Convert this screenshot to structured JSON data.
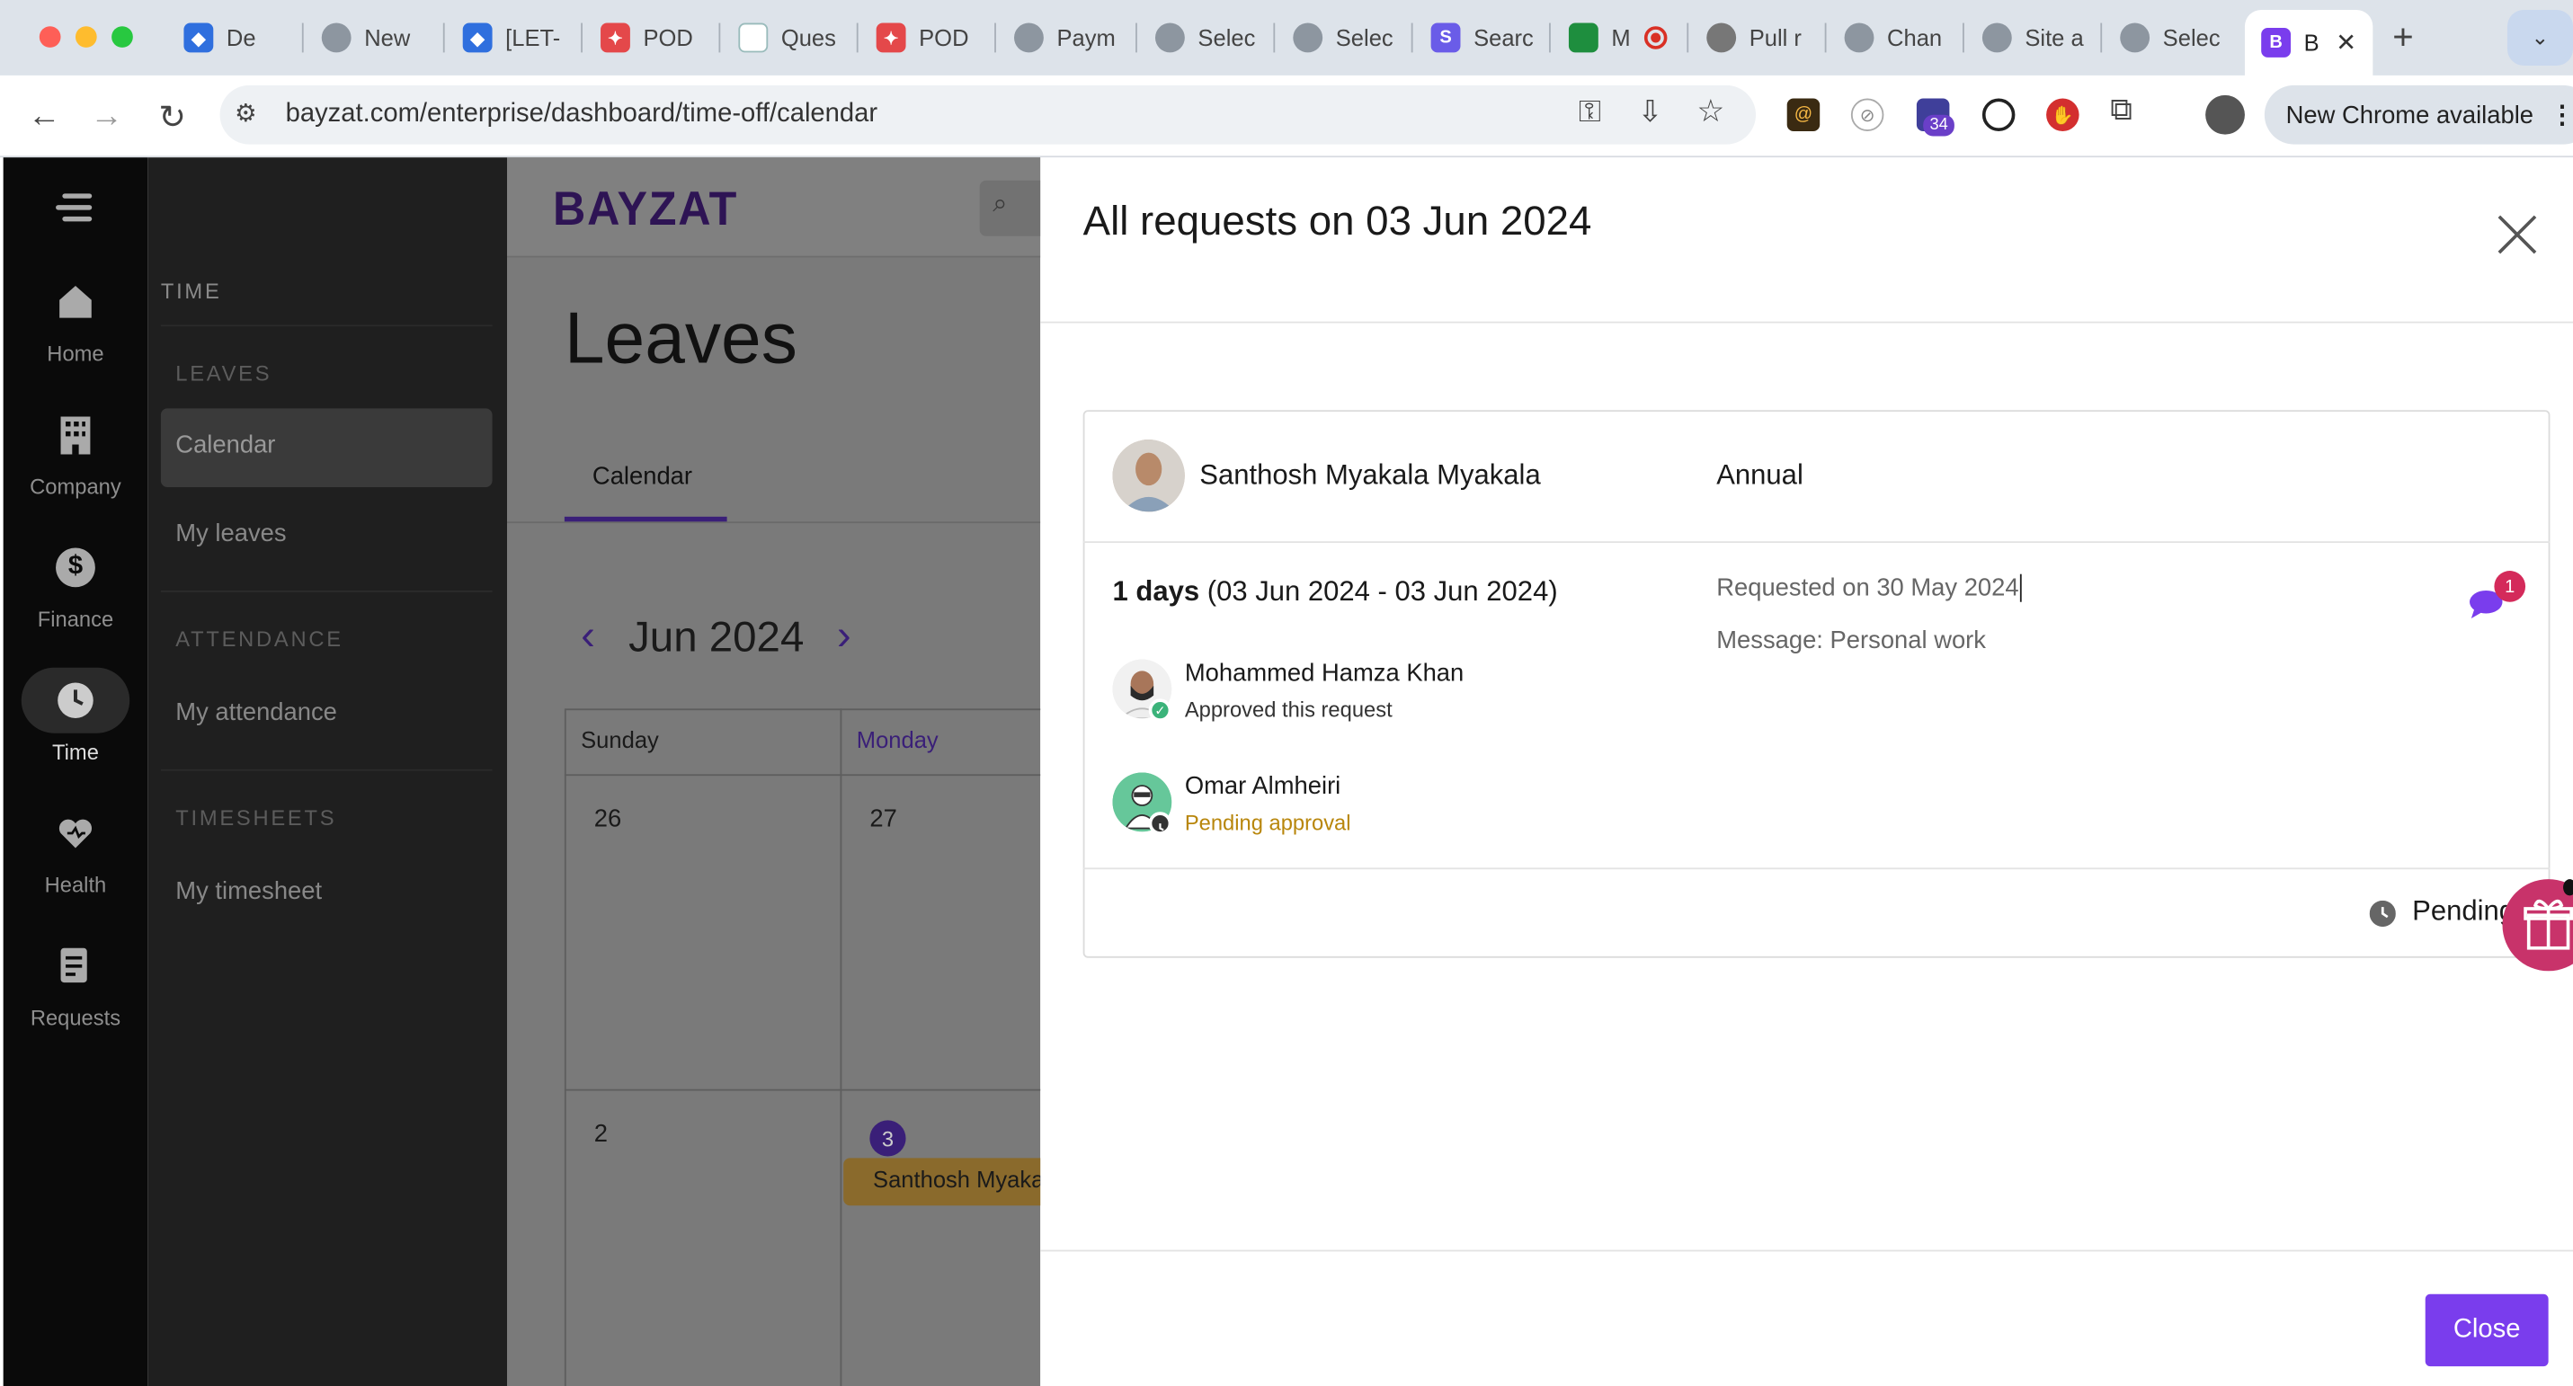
{
  "browser": {
    "tabs": [
      "De",
      "New",
      "[LET-",
      "POD",
      "Ques",
      "POD",
      "Paym",
      "Selec",
      "Selec",
      "Searc",
      "M",
      "Pull r",
      "Chan",
      "Site a",
      "Selec"
    ],
    "active_tab": "B",
    "url": "bayzat.com/enterprise/dashboard/time-off/calendar",
    "extension_badge": "34",
    "new_chrome": "New Chrome available"
  },
  "rail": {
    "items": [
      {
        "label": "Home",
        "icon": "home-icon"
      },
      {
        "label": "Company",
        "icon": "building-icon"
      },
      {
        "label": "Finance",
        "icon": "dollar-icon"
      },
      {
        "label": "Time",
        "icon": "clock-icon"
      },
      {
        "label": "Health",
        "icon": "health-icon"
      },
      {
        "label": "Requests",
        "icon": "document-icon"
      }
    ]
  },
  "subnav": {
    "section": "TIME",
    "leaves_header": "LEAVES",
    "calendar": "Calendar",
    "my_leaves": "My leaves",
    "attendance_header": "ATTENDANCE",
    "my_attendance": "My attendance",
    "timesheets_header": "TIMESHEETS",
    "my_timesheet": "My timesheet"
  },
  "main": {
    "logo": "BAYZAT",
    "title": "Leaves",
    "tab": "Calendar",
    "month": "Jun 2024",
    "days": [
      "Sunday",
      "Monday"
    ],
    "week1": [
      "26",
      "27"
    ],
    "week2": [
      "2",
      "3"
    ],
    "event": "Santhosh Myakala Myakala"
  },
  "panel": {
    "title": "All requests on 03 Jun 2024",
    "employee": "Santhosh Myakala Myakala",
    "leave_type": "Annual",
    "duration_bold": "1 days",
    "duration_range": "(03 Jun 2024 - 03 Jun 2024)",
    "requested_on": "Requested on 30 May 2024",
    "message": "Message: Personal work",
    "comment_count": "1",
    "approvers": [
      {
        "name": "Mohammed Hamza Khan",
        "status": "Approved this request"
      },
      {
        "name": "Omar Almheiri",
        "status": "Pending approval"
      }
    ],
    "status": "Pending",
    "close": "Close"
  },
  "colors": {
    "brand": "#7a3ded",
    "pending": "#b8860b",
    "event": "#c9973a"
  }
}
